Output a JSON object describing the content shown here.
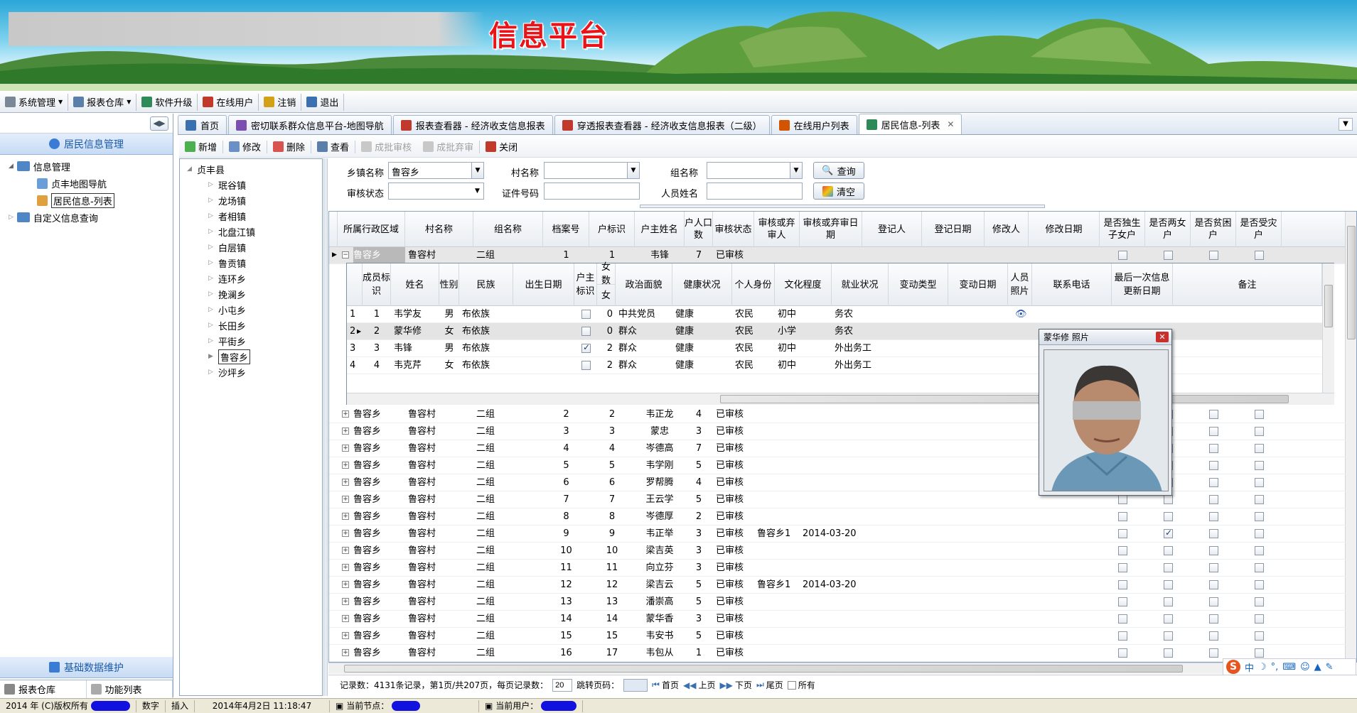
{
  "banner": {
    "title": "信息平台"
  },
  "menu": [
    {
      "label": "系统管理",
      "dd": true
    },
    {
      "label": "报表仓库",
      "dd": true
    },
    {
      "label": "软件升级"
    },
    {
      "label": "在线用户"
    },
    {
      "label": "注销"
    },
    {
      "label": "退出"
    }
  ],
  "left": {
    "section": "居民信息管理",
    "tree": [
      {
        "label": "信息管理"
      },
      {
        "label": "贞丰地图导航"
      },
      {
        "label": "居民信息-列表"
      },
      {
        "label": "自定义信息查询"
      }
    ],
    "bottom_section": "基础数据维护",
    "bottom_tabs": [
      "报表仓库",
      "功能列表"
    ]
  },
  "tabs": [
    "首页",
    "密切联系群众信息平台-地图导航",
    "报表查看器 - 经济收支信息报表",
    "穿透报表查看器 - 经济收支信息报表（二级）",
    "在线用户列表",
    "居民信息-列表"
  ],
  "toolbar": {
    "add": "新增",
    "edit": "修改",
    "delete": "删除",
    "view": "查看",
    "batch_approve": "成批审核",
    "batch_discard": "成批弃审",
    "close": "关闭"
  },
  "region_tree": {
    "root": "贞丰县",
    "items": [
      "珉谷镇",
      "龙场镇",
      "者相镇",
      "北盘江镇",
      "白层镇",
      "鲁贡镇",
      "连环乡",
      "挽澜乡",
      "小屯乡",
      "长田乡",
      "平街乡",
      "鲁容乡",
      "沙坪乡"
    ],
    "selected": "鲁容乡"
  },
  "filter": {
    "town_label": "乡镇名称",
    "town_value": "鲁容乡",
    "village_label": "村名称",
    "village_value": "",
    "group_label": "组名称",
    "group_value": "",
    "status_label": "审核状态",
    "status_value": "",
    "id_label": "证件号码",
    "id_value": "",
    "person_label": "人员姓名",
    "person_value": "",
    "query": "查询",
    "clear": "清空"
  },
  "grid": {
    "headers": [
      "所属行政区域",
      "村名称",
      "组名称",
      "档案号",
      "户标识",
      "户主姓名",
      "户人口数",
      "审核状态",
      "审核或弃审人",
      "审核或弃审日期",
      "登记人",
      "登记日期",
      "修改人",
      "修改日期",
      "是否独生子女户",
      "是否两女户",
      "是否贫困户",
      "是否受灾户"
    ],
    "first": [
      "鲁容乡",
      "鲁容村",
      "二组",
      "1",
      "1",
      "韦锋",
      "7",
      "已审核"
    ],
    "rows": [
      [
        "鲁容乡",
        "鲁容村",
        "二组",
        "2",
        "2",
        "韦正龙",
        "4",
        "已审核",
        "",
        "",
        false,
        false
      ],
      [
        "鲁容乡",
        "鲁容村",
        "二组",
        "3",
        "3",
        "蒙忠",
        "3",
        "已审核",
        "",
        "",
        false,
        false
      ],
      [
        "鲁容乡",
        "鲁容村",
        "二组",
        "4",
        "4",
        "岑德高",
        "7",
        "已审核",
        "",
        "",
        false,
        false
      ],
      [
        "鲁容乡",
        "鲁容村",
        "二组",
        "5",
        "5",
        "韦学刚",
        "5",
        "已审核",
        "",
        "",
        false,
        false
      ],
      [
        "鲁容乡",
        "鲁容村",
        "二组",
        "6",
        "6",
        "罗帮腾",
        "4",
        "已审核",
        "",
        "",
        false,
        false
      ],
      [
        "鲁容乡",
        "鲁容村",
        "二组",
        "7",
        "7",
        "王云学",
        "5",
        "已审核",
        "",
        "",
        false,
        false
      ],
      [
        "鲁容乡",
        "鲁容村",
        "二组",
        "8",
        "8",
        "岑德厚",
        "2",
        "已审核",
        "",
        "",
        false,
        false
      ],
      [
        "鲁容乡",
        "鲁容村",
        "二组",
        "9",
        "9",
        "韦正举",
        "3",
        "已审核",
        "鲁容乡1",
        "2014-03-20",
        false,
        true
      ],
      [
        "鲁容乡",
        "鲁容村",
        "二组",
        "10",
        "10",
        "梁吉英",
        "3",
        "已审核",
        "",
        "",
        false,
        false
      ],
      [
        "鲁容乡",
        "鲁容村",
        "二组",
        "11",
        "11",
        "向立芬",
        "3",
        "已审核",
        "",
        "",
        false,
        false
      ],
      [
        "鲁容乡",
        "鲁容村",
        "二组",
        "12",
        "12",
        "梁吉云",
        "5",
        "已审核",
        "鲁容乡1",
        "2014-03-20",
        false,
        false
      ],
      [
        "鲁容乡",
        "鲁容村",
        "二组",
        "13",
        "13",
        "潘崇高",
        "5",
        "已审核",
        "",
        "",
        false,
        false
      ],
      [
        "鲁容乡",
        "鲁容村",
        "二组",
        "14",
        "14",
        "蒙华香",
        "3",
        "已审核",
        "",
        "",
        false,
        false
      ],
      [
        "鲁容乡",
        "鲁容村",
        "二组",
        "15",
        "15",
        "韦安书",
        "5",
        "已审核",
        "",
        "",
        false,
        false
      ],
      [
        "鲁容乡",
        "鲁容村",
        "二组",
        "16",
        "17",
        "韦包从",
        "1",
        "已审核",
        "",
        "",
        false,
        false
      ]
    ]
  },
  "detail": {
    "headers": [
      "成员标识",
      "姓名",
      "性别",
      "民族",
      "出生日期",
      "户主标识",
      "女数",
      "女",
      "政治面貌",
      "健康状况",
      "个人身份",
      "文化程度",
      "就业状况",
      "变动类型",
      "变动日期",
      "人员照片",
      "联系电话",
      "最后一次信息更新日期",
      "备注"
    ],
    "rows": [
      {
        "n": "1",
        "id": "1",
        "name": "韦学友",
        "sex": "男",
        "eth": "布依族",
        "head": false,
        "f": "0",
        "pol": "中共党员",
        "health": "健康",
        "ident": "农民",
        "edu": "初中",
        "job": "务农"
      },
      {
        "n": "2",
        "id": "2",
        "name": "蒙华修",
        "sex": "女",
        "eth": "布依族",
        "head": false,
        "f": "0",
        "pol": "群众",
        "health": "健康",
        "ident": "农民",
        "edu": "小学",
        "job": "务农"
      },
      {
        "n": "3",
        "id": "3",
        "name": "韦锋",
        "sex": "男",
        "eth": "布依族",
        "head": true,
        "f": "2",
        "pol": "群众",
        "health": "健康",
        "ident": "农民",
        "edu": "初中",
        "job": "外出务工"
      },
      {
        "n": "4",
        "id": "4",
        "name": "韦克芹",
        "sex": "女",
        "eth": "布依族",
        "head": false,
        "f": "2",
        "pol": "群众",
        "health": "健康",
        "ident": "农民",
        "edu": "初中",
        "job": "外出务工"
      }
    ]
  },
  "popup": {
    "title": "蒙华修 照片"
  },
  "pager": {
    "summary": "记录数：4131条记录，第1页/共207页，每页记录数：",
    "page_size": "20",
    "jump": "跳转页码：",
    "first": "首页",
    "prev": "上页",
    "next": "下页",
    "last": "尾页",
    "all": "所有"
  },
  "status": {
    "copyright": "2014 年 (C)版权所有",
    "num": "数字",
    "ins": "插入",
    "datetime": "2014年4月2日  11:18:47",
    "node": "当前节点：",
    "user": "当前用户："
  },
  "ime": {
    "lang": "中"
  }
}
